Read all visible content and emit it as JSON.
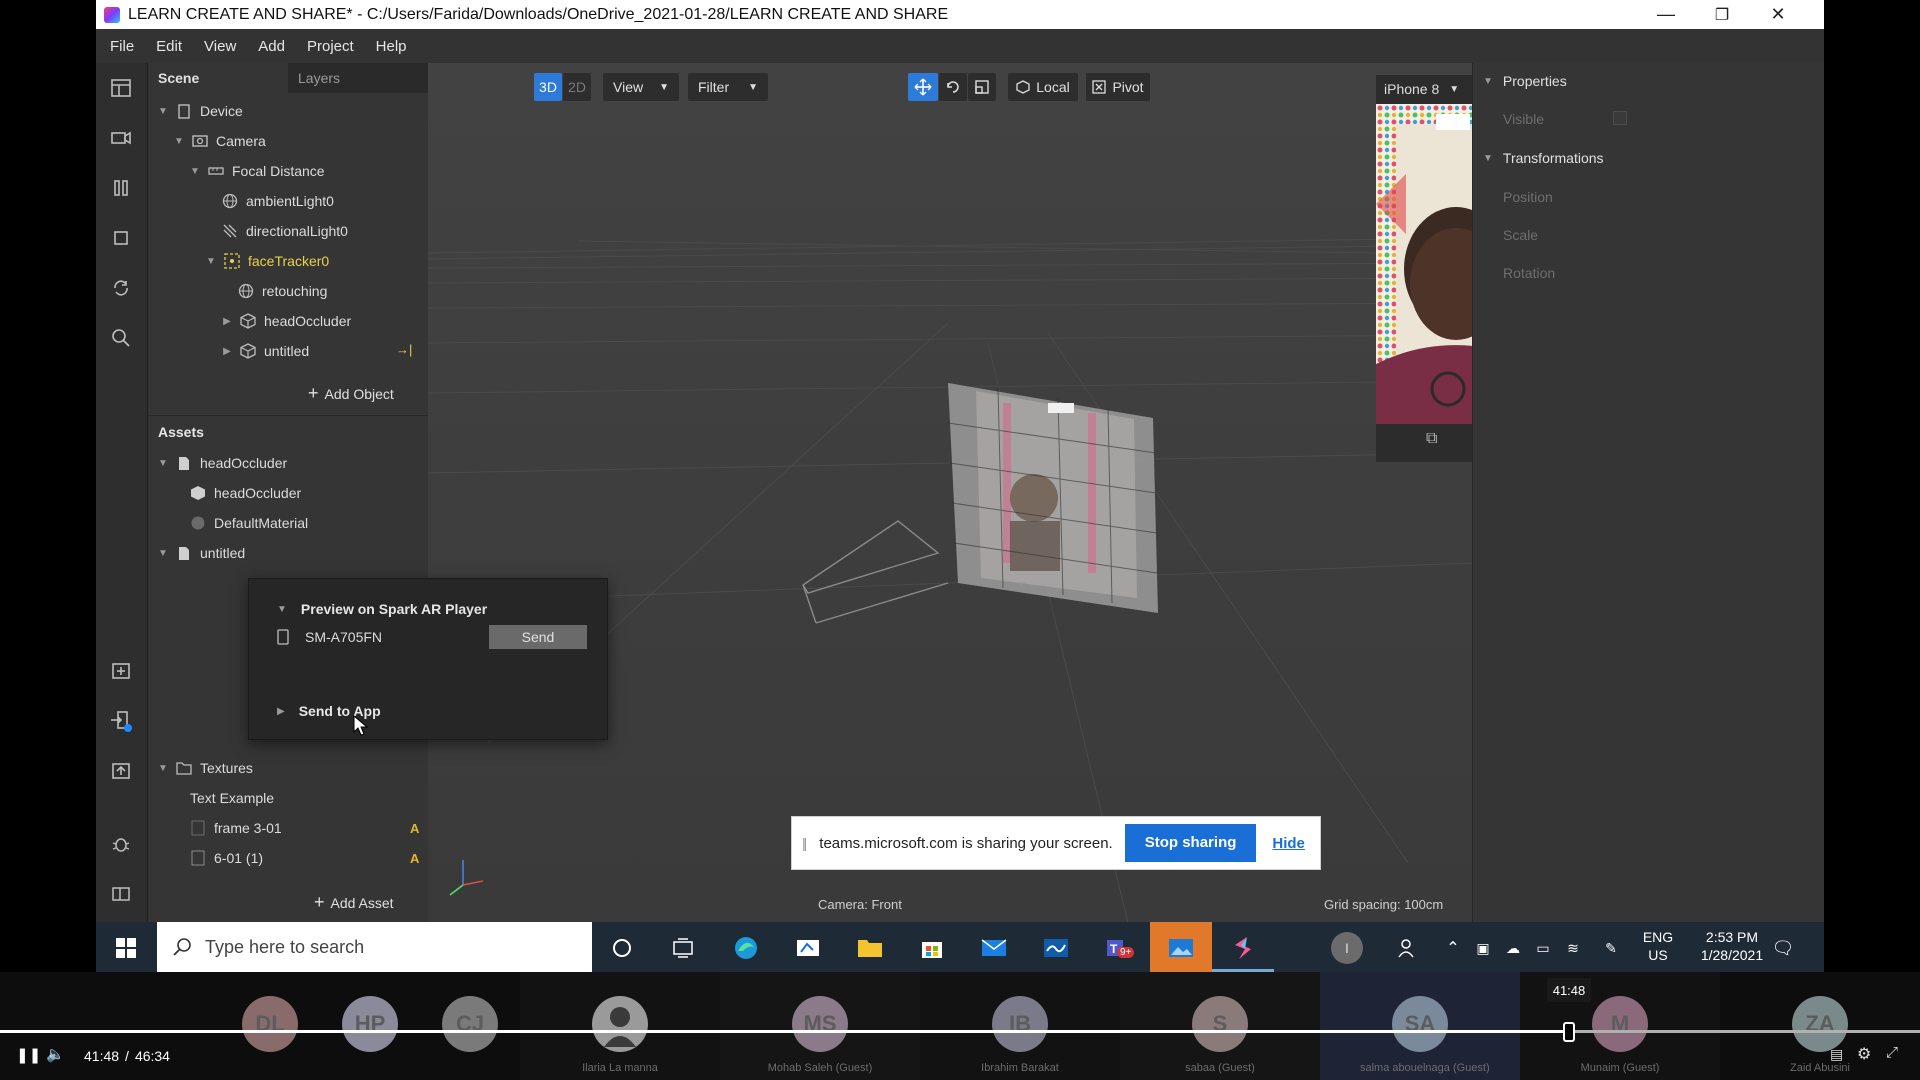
{
  "window": {
    "title": "LEARN CREATE AND SHARE* - C:/Users/Farida/Downloads/OneDrive_2021-01-28/LEARN CREATE AND SHARE",
    "minimize": "—",
    "restore": "❐",
    "close": "✕"
  },
  "menu": [
    "File",
    "Edit",
    "View",
    "Add",
    "Project",
    "Help"
  ],
  "scene": {
    "tab_scene": "Scene",
    "tab_layers": "Layers",
    "items": [
      {
        "label": "Device"
      },
      {
        "label": "Camera"
      },
      {
        "label": "Focal Distance"
      },
      {
        "label": "ambientLight0"
      },
      {
        "label": "directionalLight0"
      },
      {
        "label": "faceTracker0"
      },
      {
        "label": "retouching"
      },
      {
        "label": "headOccluder"
      },
      {
        "label": "untitled"
      }
    ],
    "add_object": "Add Object",
    "arrow_glyph": "→|"
  },
  "assets": {
    "title": "Assets",
    "items": [
      {
        "label": "headOccluder"
      },
      {
        "label": "headOccluder"
      },
      {
        "label": "DefaultMaterial"
      },
      {
        "label": "untitled"
      },
      {
        "label": "Textures"
      },
      {
        "label": "Text Example"
      },
      {
        "label": "frame 3-01"
      },
      {
        "label": "6-01 (1)"
      }
    ],
    "warn_glyph": "A",
    "add_asset": "Add Asset"
  },
  "popup": {
    "preview_title": "Preview on Spark AR Player",
    "device": "SM-A705FN",
    "send": "Send",
    "send_to_app": "Send to App"
  },
  "viewport": {
    "btn_3d": "3D",
    "btn_2d": "2D",
    "view": "View",
    "filter": "Filter",
    "local": "Local",
    "pivot": "Pivot",
    "device": "iPhone 8",
    "camera": "Camera: Front",
    "grid": "Grid spacing: 100cm"
  },
  "properties": {
    "title": "Properties",
    "visible": "Visible",
    "transformations": "Transformations",
    "position": "Position",
    "scale": "Scale",
    "rotation": "Rotation"
  },
  "sharing": {
    "text": "teams.microsoft.com is sharing your screen.",
    "stop": "Stop sharing",
    "hide": "Hide"
  },
  "taskbar": {
    "search_placeholder": "Type here to search",
    "lang": "ENG",
    "region": "US",
    "time": "2:53 PM",
    "date": "1/28/2021",
    "teams_badge": "9+",
    "user_initial": "I"
  },
  "video": {
    "current": "41:48",
    "separator": "/",
    "total": "46:34",
    "tooltip": "41:48",
    "progress": 0.8978
  },
  "participants": [
    {
      "initials": "DL",
      "name": "",
      "color": "#8a6b6b"
    },
    {
      "initials": "HP",
      "name": "",
      "color": "#8a8a9a"
    },
    {
      "initials": "CJ",
      "name": "",
      "color": "#7a7a7a"
    },
    {
      "initials": "",
      "name": "Ilaria La manna",
      "color": "#9a9a9a"
    },
    {
      "initials": "MS",
      "name": "Mohab Saleh (Guest)",
      "color": "#8a7a8a"
    },
    {
      "initials": "IB",
      "name": "Ibrahim Barakat",
      "color": "#7a7a8a"
    },
    {
      "initials": "S",
      "name": "sabaa (Guest)",
      "color": "#8a7a7a"
    },
    {
      "initials": "SA",
      "name": "salma abouelnaga (Guest)",
      "color": "#7a8a9a"
    },
    {
      "initials": "M",
      "name": "Munaim (Guest)",
      "color": "#8a6a7a"
    },
    {
      "initials": "ZA",
      "name": "Zaid Abusini",
      "color": "#7a8a8a"
    }
  ]
}
